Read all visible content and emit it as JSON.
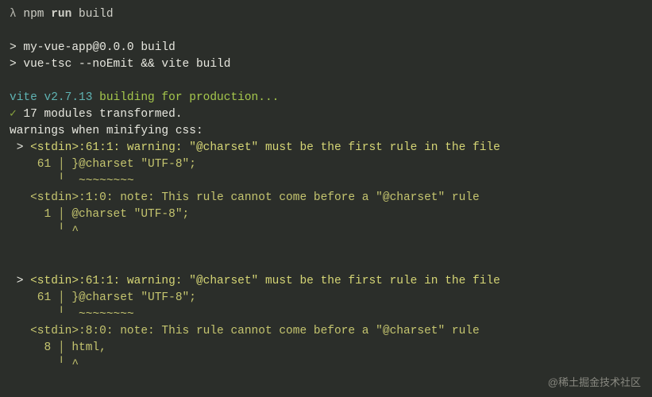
{
  "cmd": {
    "prompt": "λ",
    "npm": "npm",
    "run": "run",
    "build": "build"
  },
  "output": {
    "script1": "> my-vue-app@0.0.0 build",
    "script2": "> vue-tsc --noEmit && vite build",
    "vite_prefix": "vite v2.7.13",
    "vite_msg": " building for production...",
    "check": "✓",
    "transformed": " 17 modules transformed.",
    "warn_header": "warnings when minifying css:",
    "w1": {
      "gt": " >",
      "line1": " <stdin>:61:1: warning: \"@charset\" must be the first rule in the file",
      "line2": "    61 │ }@charset \"UTF-8\";",
      "line3": "       ╵  ~~~~~~~~",
      "line4": "   <stdin>:1:0: note: This rule cannot come before a \"@charset\" rule",
      "line5": "     1 │ @charset \"UTF-8\";",
      "line6": "       ╵ ^"
    },
    "w2": {
      "gt": " >",
      "line1": " <stdin>:61:1: warning: \"@charset\" must be the first rule in the file",
      "line2": "    61 │ }@charset \"UTF-8\";",
      "line3": "       ╵  ~~~~~~~~",
      "line4": "   <stdin>:8:0: note: This rule cannot come before a \"@charset\" rule",
      "line5": "     8 │ html,",
      "line6": "       ╵ ^"
    }
  },
  "watermark": "@稀土掘金技术社区"
}
